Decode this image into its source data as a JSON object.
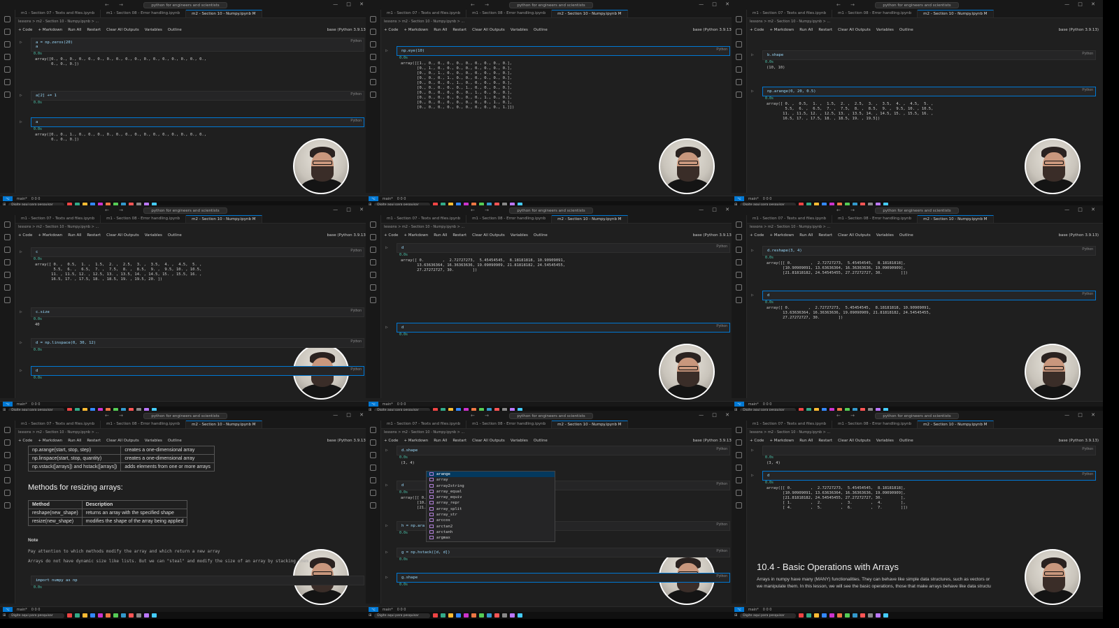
{
  "common": {
    "search": "python for engineers and scientists",
    "tabs": [
      "m1 - Section 07 - Texts and files.ipynb",
      "m1 - Section 08 - Error handling.ipynb",
      "m2 - Section 10 - Numpy.ipynb M"
    ],
    "breadcrumb": "lessons > m2 - Section 10 - Numpy.ipynb > ...",
    "toolbar": [
      "+ Code",
      "+ Markdown",
      "Run All",
      "Restart",
      "Clear All Outputs",
      "Variables",
      "Outline"
    ],
    "kernel": "base (Python 3.9.13)",
    "lang": "Python",
    "tick": "0.0s",
    "status_remote": "main*",
    "status_errors": "0 0 0",
    "taskbar_search": "Digite aqui para pesquisar"
  },
  "tiles": [
    {
      "cells": [
        {
          "code": "a = np.zeros(20)\na",
          "out": "array([0., 0., 0., 0., 0., 0., 0., 0., 0., 0., 0., 0., 0., 0., 0., 0., 0.,\n       0., 0., 0.])"
        },
        {
          "code": "a[2] += 1",
          "out": ""
        },
        {
          "code": "a",
          "out": "array([0., 0., 1., 0., 0., 0., 0., 0., 0., 0., 0., 0., 0., 0., 0., 0., 0.,\n       0., 0., 0.])"
        }
      ]
    },
    {
      "cells": [
        {
          "code": "np.eye(10)",
          "out": "array([[1., 0., 0., 0., 0., 0., 0., 0., 0., 0.],\n       [0., 1., 0., 0., 0., 0., 0., 0., 0., 0.],\n       [0., 0., 1., 0., 0., 0., 0., 0., 0., 0.],\n       [0., 0., 0., 1., 0., 0., 0., 0., 0., 0.],\n       [0., 0., 0., 0., 1., 0., 0., 0., 0., 0.],\n       [0., 0., 0., 0., 0., 1., 0., 0., 0., 0.],\n       [0., 0., 0., 0., 0., 0., 1., 0., 0., 0.],\n       [0., 0., 0., 0., 0., 0., 0., 1., 0., 0.],\n       [0., 0., 0., 0., 0., 0., 0., 0., 1., 0.],\n       [0., 0., 0., 0., 0., 0., 0., 0., 0., 1.]])"
        }
      ]
    },
    {
      "cells": [
        {
          "code": "b.shape",
          "out": "(10, 10)"
        },
        {
          "code": "np.arange(0, 20, 0.5)",
          "out": "array([ 0. ,  0.5,  1. ,  1.5,  2. ,  2.5,  3. ,  3.5,  4. ,  4.5,  5. ,\n        5.5,  6. ,  6.5,  7. ,  7.5,  8. ,  8.5,  9. ,  9.5, 10. , 10.5,\n       11. , 11.5, 12. , 12.5, 13. , 13.5, 14. , 14.5, 15. , 15.5, 16. ,\n       16.5, 17. , 17.5, 18. , 18.5, 19. , 19.5])"
        }
      ]
    },
    {
      "cells": [
        {
          "code": "c",
          "out": "array([ 0. ,  0.5,  1. ,  1.5,  2. ,  2.5,  3. ,  3.5,  4. ,  4.5,  5. ,\n        5.5,  6. ,  6.5,  7. ,  7.5,  8. ,  8.5,  9. ,  9.5, 10. , 10.5,\n       11. , 11.5, 12. , 12.5, 13. , 13.5, 14. , 14.5, 15. , 15.5, 16. ,\n       16.5, 17. , 17.5, 18. , 18.5, 19. , 19.5, 20. ])"
        },
        {
          "code": "c.size",
          "out": "40"
        },
        {
          "code": "d = np.linspace(0, 30, 12)",
          "out": ""
        },
        {
          "code": "d",
          "out": ""
        }
      ]
    },
    {
      "cells": [
        {
          "code": "d",
          "out": "array([ 0.        ,  2.72727273,  5.45454545,  8.18181818, 10.90909091,\n       13.63636364, 16.36363636, 19.09090909, 21.81818182, 24.54545455,\n       27.27272727, 30.        ])"
        },
        {
          "code": "d",
          "out": ""
        }
      ]
    },
    {
      "cells": [
        {
          "code": "d.reshape(3, 4)",
          "out": "array([[ 0.        ,  2.72727273,  5.45454545,  8.18181818],\n       [10.90909091, 13.63636364, 16.36363636, 19.09090909],\n       [21.81818182, 24.54545455, 27.27272727, 30.        ]])"
        },
        {
          "code": "d",
          "out": "array([ 0.        ,  2.72727273,  5.45454545,  8.18181818, 10.90909091,\n       13.63636364, 16.36363636, 19.09090909, 21.81818182, 24.54545455,\n       27.27272727, 30.        ])"
        }
      ]
    },
    {
      "table1": [
        [
          "np.arange(start, stop, step)",
          "creates a one-dimensional array"
        ],
        [
          "np.linspace(start, stop, quantity)",
          "creates a one-dimensional array"
        ],
        [
          "np.vstack([arrays]) and hstack([arrays])",
          "adds elements from one or more arrays"
        ]
      ],
      "heading": "Methods for resizing arrays:",
      "table2_head": [
        "Method",
        "Description"
      ],
      "table2": [
        [
          "reshape(new_shape)",
          "returns an array with the specified shape"
        ],
        [
          "resize(new_shape)",
          "modifies the shape of the array being applied"
        ]
      ],
      "note_title": "Note",
      "note1": "Pay attention to which methods modify the array and which return a new array",
      "note2": "Arrays do not have dynamic size like lists. But we can \"steal\" and modify the size of an array by stacking them",
      "code": "import numpy as np"
    },
    {
      "cells": [
        {
          "code": "d.shape",
          "out": "(3, 4)"
        },
        {
          "code": "d",
          "out": "array([[ 0.\n       [10.90\n       [21.81"
        },
        {
          "code": "h = np.ara",
          "out": ""
        },
        {
          "code": "g = np.hstack([d, d])",
          "out": ""
        },
        {
          "code": "g.shape",
          "out": ""
        }
      ],
      "autocomplete": [
        "arange",
        "array",
        "array2string",
        "array_equal",
        "array_equiv",
        "array_repr",
        "array_split",
        "array_str",
        "arccos",
        "arctan2",
        "arctanh",
        "argmax"
      ]
    },
    {
      "cells": [
        {
          "code": "",
          "out": "(3, 4)"
        },
        {
          "code": "d",
          "out": "array([[ 0.        ,  2.72727273,  5.45454545,  8.18181818],\n       [10.90909091, 13.63636364, 16.36363636, 19.09090909],\n       [21.81818182, 24.54545455, 27.27272727, 30.        ],\n       [ 1.        ,  2.        ,  3.        ,  4.        ],\n       [ 4.        ,  5.        ,  6.        ,  7.        ]])"
        }
      ],
      "heading": "10.4 - Basic Operations with Arrays",
      "para1": "Arrays in numpy have many (MANY) functionalities. They can behave like simple data structures, such as vectors or",
      "para2": "we manipulate them. In this lesson, we will see the basic operations, those that make arrays behave like data structu"
    }
  ]
}
